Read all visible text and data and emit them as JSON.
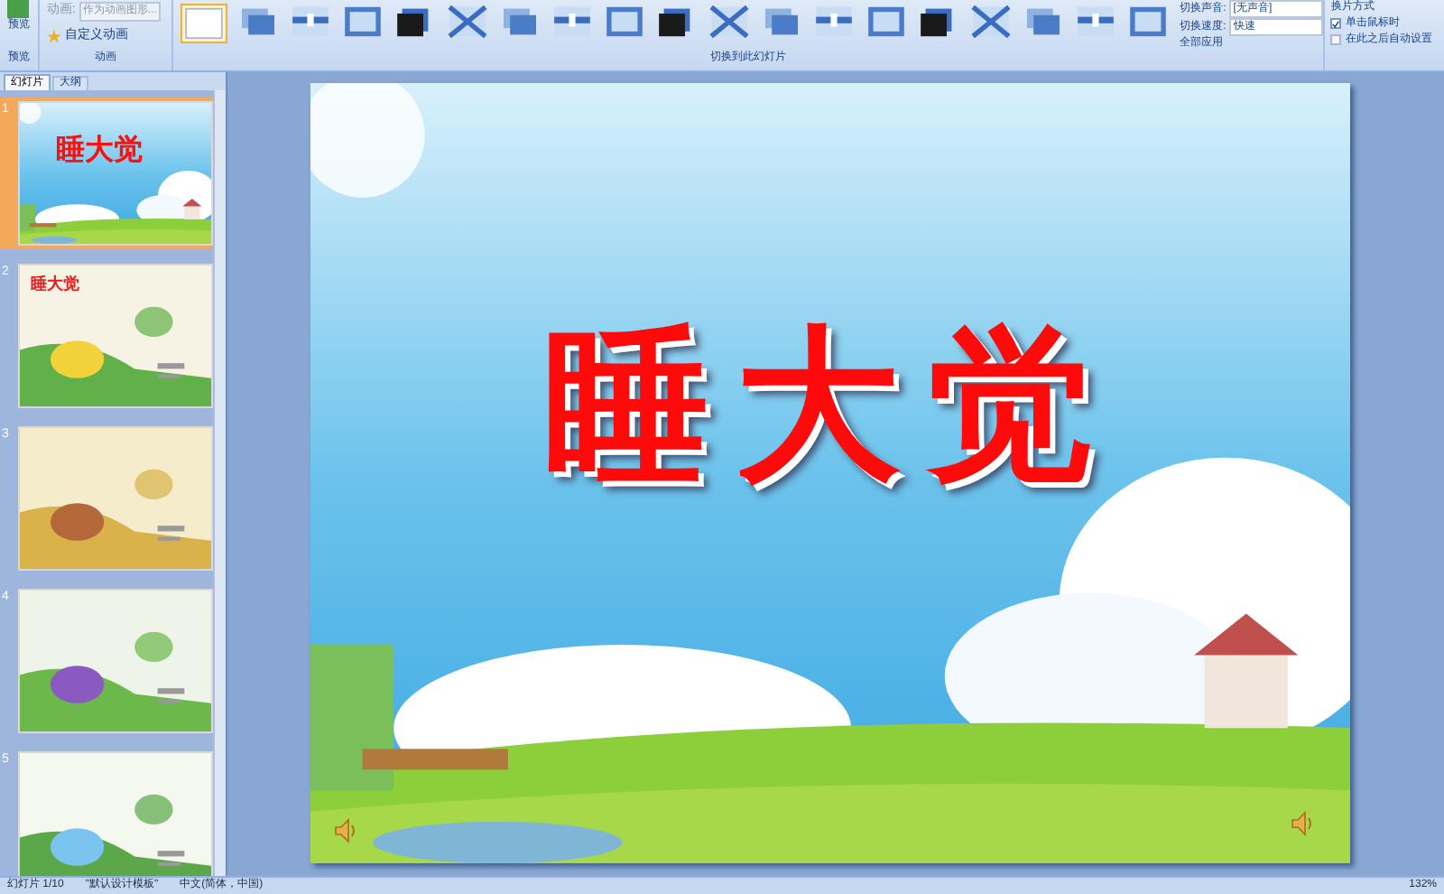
{
  "ribbon": {
    "preview_group": {
      "button": "预览",
      "label": "预览"
    },
    "animation_group": {
      "field_label": "动画:",
      "field_value": "作为动画图形...",
      "custom_button": "自定义动画",
      "label": "动画"
    },
    "transition_group": {
      "label": "切换到此幻灯片",
      "sound_label": "切换声音:",
      "sound_value": "[无声音]",
      "speed_label": "切换速度:",
      "speed_value": "快速",
      "apply_all": "全部应用"
    },
    "advance_group": {
      "title": "换片方式",
      "options": [
        {
          "label": "单击鼠标时",
          "checked": true
        },
        {
          "label": "在此之后自动设置",
          "checked": false
        }
      ]
    }
  },
  "pane": {
    "tabs": [
      {
        "label": "幻灯片",
        "selected": true
      },
      {
        "label": "大纲",
        "selected": false
      }
    ],
    "slides": [
      {
        "number": "1",
        "title": "睡大觉",
        "selected": true
      },
      {
        "number": "2",
        "title": "睡大觉",
        "selected": false
      },
      {
        "number": "3",
        "selected": false
      },
      {
        "number": "4",
        "selected": false
      },
      {
        "number": "5",
        "selected": false
      }
    ]
  },
  "slide": {
    "title": "睡大觉"
  },
  "status_bar": {
    "slide": "幻灯片 1/10",
    "theme": "\"默认设计模板\"",
    "language": "中文(简体，中国)",
    "zoom": "132%"
  }
}
